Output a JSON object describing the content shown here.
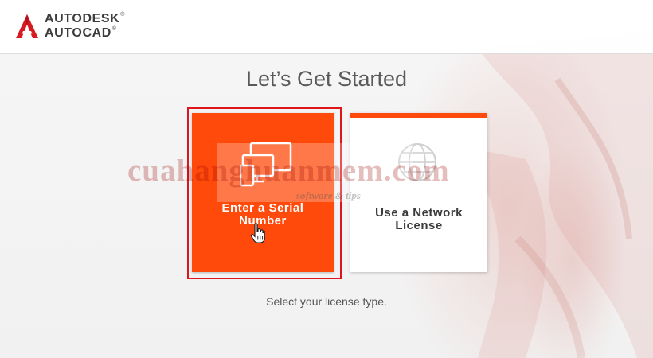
{
  "brand": {
    "company": "AUTODESK",
    "product": "AUTOCAD",
    "registered_mark": "®"
  },
  "page": {
    "title": "Let’s Get Started",
    "prompt": "Select your license type."
  },
  "options": [
    {
      "label": "Enter a Serial Number",
      "line1": "Enter a Serial",
      "line2": "Number",
      "icon": "multi-device-icon",
      "state": "hovered-selected"
    },
    {
      "label": "Use a Network License",
      "line1": "Use a Network",
      "line2": "License",
      "icon": "globe-icon",
      "state": "default"
    }
  ],
  "watermark": {
    "text": "cuahanghuanmem.com",
    "subtext": "software & tips"
  },
  "colors": {
    "accent": "#ff4a0b",
    "highlight_border": "#e0151b",
    "brand_red": "#d8191f",
    "text_gray": "#5a5a5a"
  }
}
